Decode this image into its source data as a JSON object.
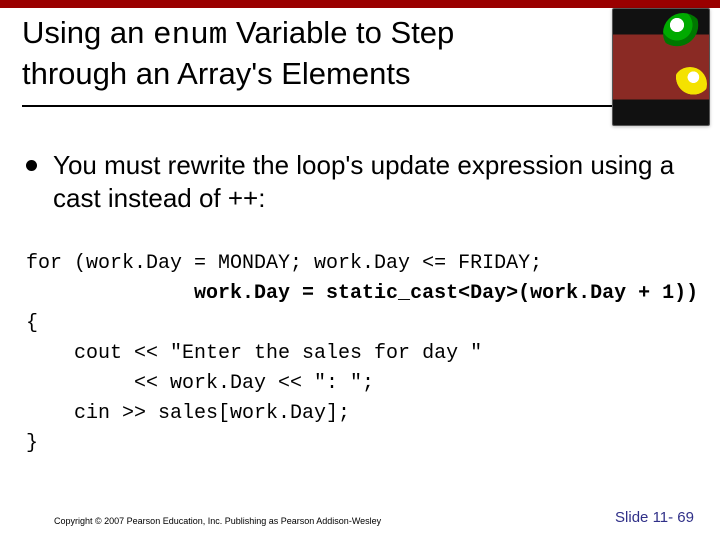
{
  "title": {
    "prefix": "Using an ",
    "code": "enum",
    "suffix": " Variable to Step through an Array's Elements"
  },
  "bullet": "You must rewrite the loop's update expression using a cast instead of ++:",
  "code": {
    "l1": "for (work.Day = MONDAY; work.Day <= FRIDAY;",
    "l2": "              work.Day = static_cast<Day>(work.Day + 1))",
    "l3": "{",
    "l4": "    cout << \"Enter the sales for day \"",
    "l5": "         << work.Day << \": \";",
    "l6": "    cin >> sales[work.Day];",
    "l7": "}"
  },
  "footer": {
    "copyright": "Copyright © 2007 Pearson Education, Inc. Publishing as Pearson Addison-Wesley",
    "slide": "Slide 11- 69"
  }
}
